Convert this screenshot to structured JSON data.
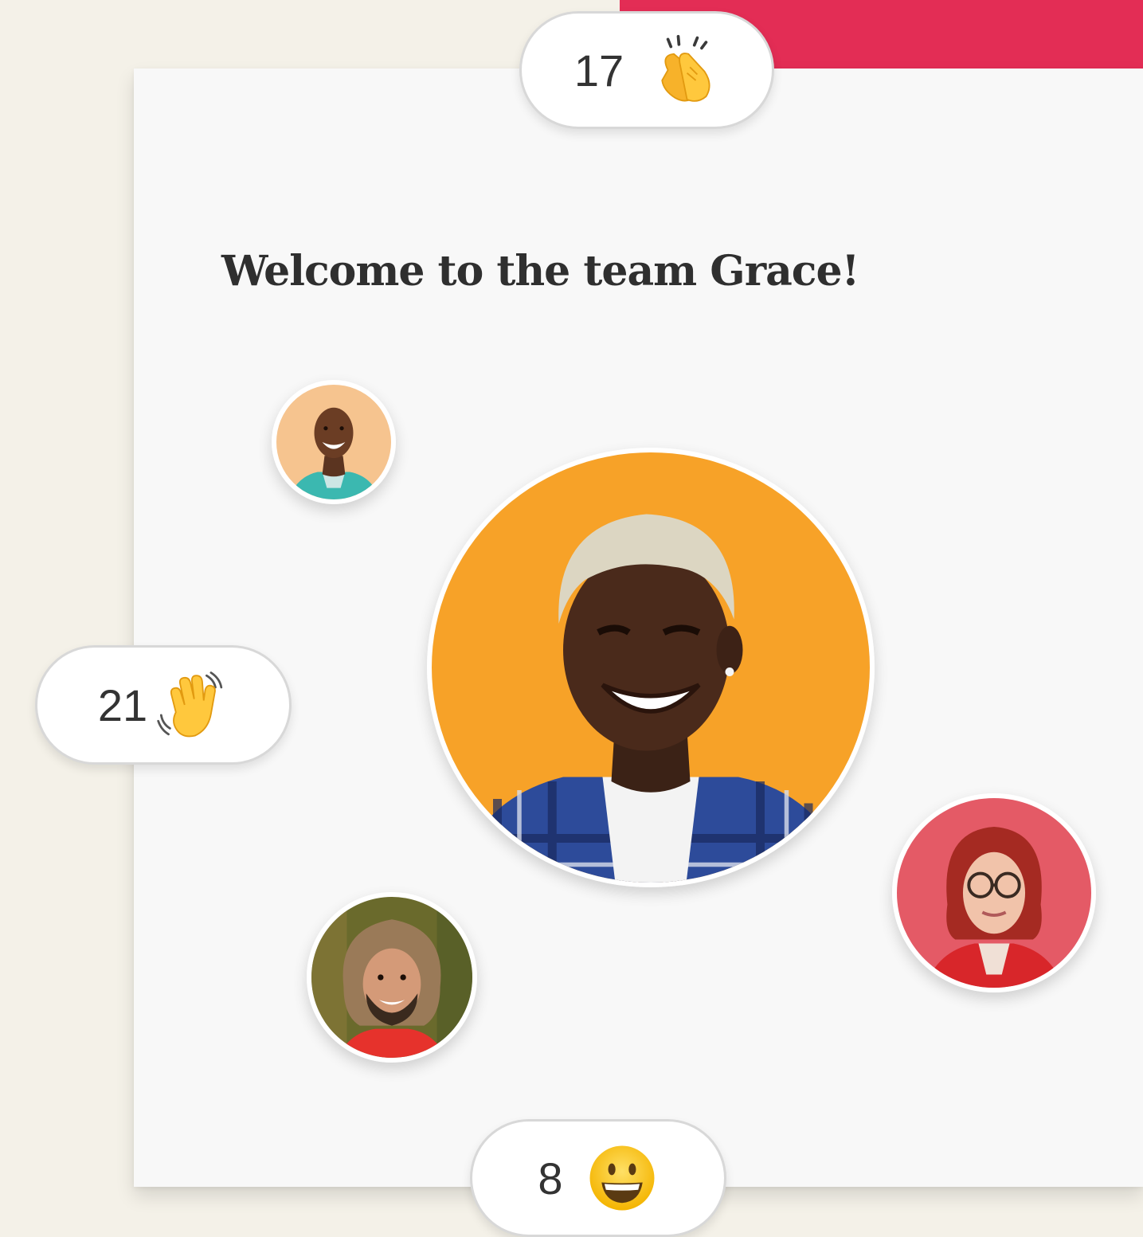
{
  "welcome": {
    "title": "Welcome to the team Grace!"
  },
  "reactions": {
    "clap": {
      "count": "17",
      "icon": "clapping-hands-icon"
    },
    "wave": {
      "count": "21",
      "icon": "waving-hand-icon"
    },
    "smile": {
      "count": "8",
      "icon": "grinning-face-icon"
    }
  },
  "avatars": [
    {
      "role": "new-member",
      "icon": "person-avatar"
    },
    {
      "role": "teammate",
      "icon": "person-avatar"
    },
    {
      "role": "teammate",
      "icon": "person-avatar"
    },
    {
      "role": "teammate",
      "icon": "person-avatar"
    }
  ],
  "colors": {
    "background": "#f4f1e8",
    "card": "#f8f8f8",
    "accent": "#e32d55",
    "grace_bg": "#f7a228",
    "woman_bg": "#e45a66"
  }
}
